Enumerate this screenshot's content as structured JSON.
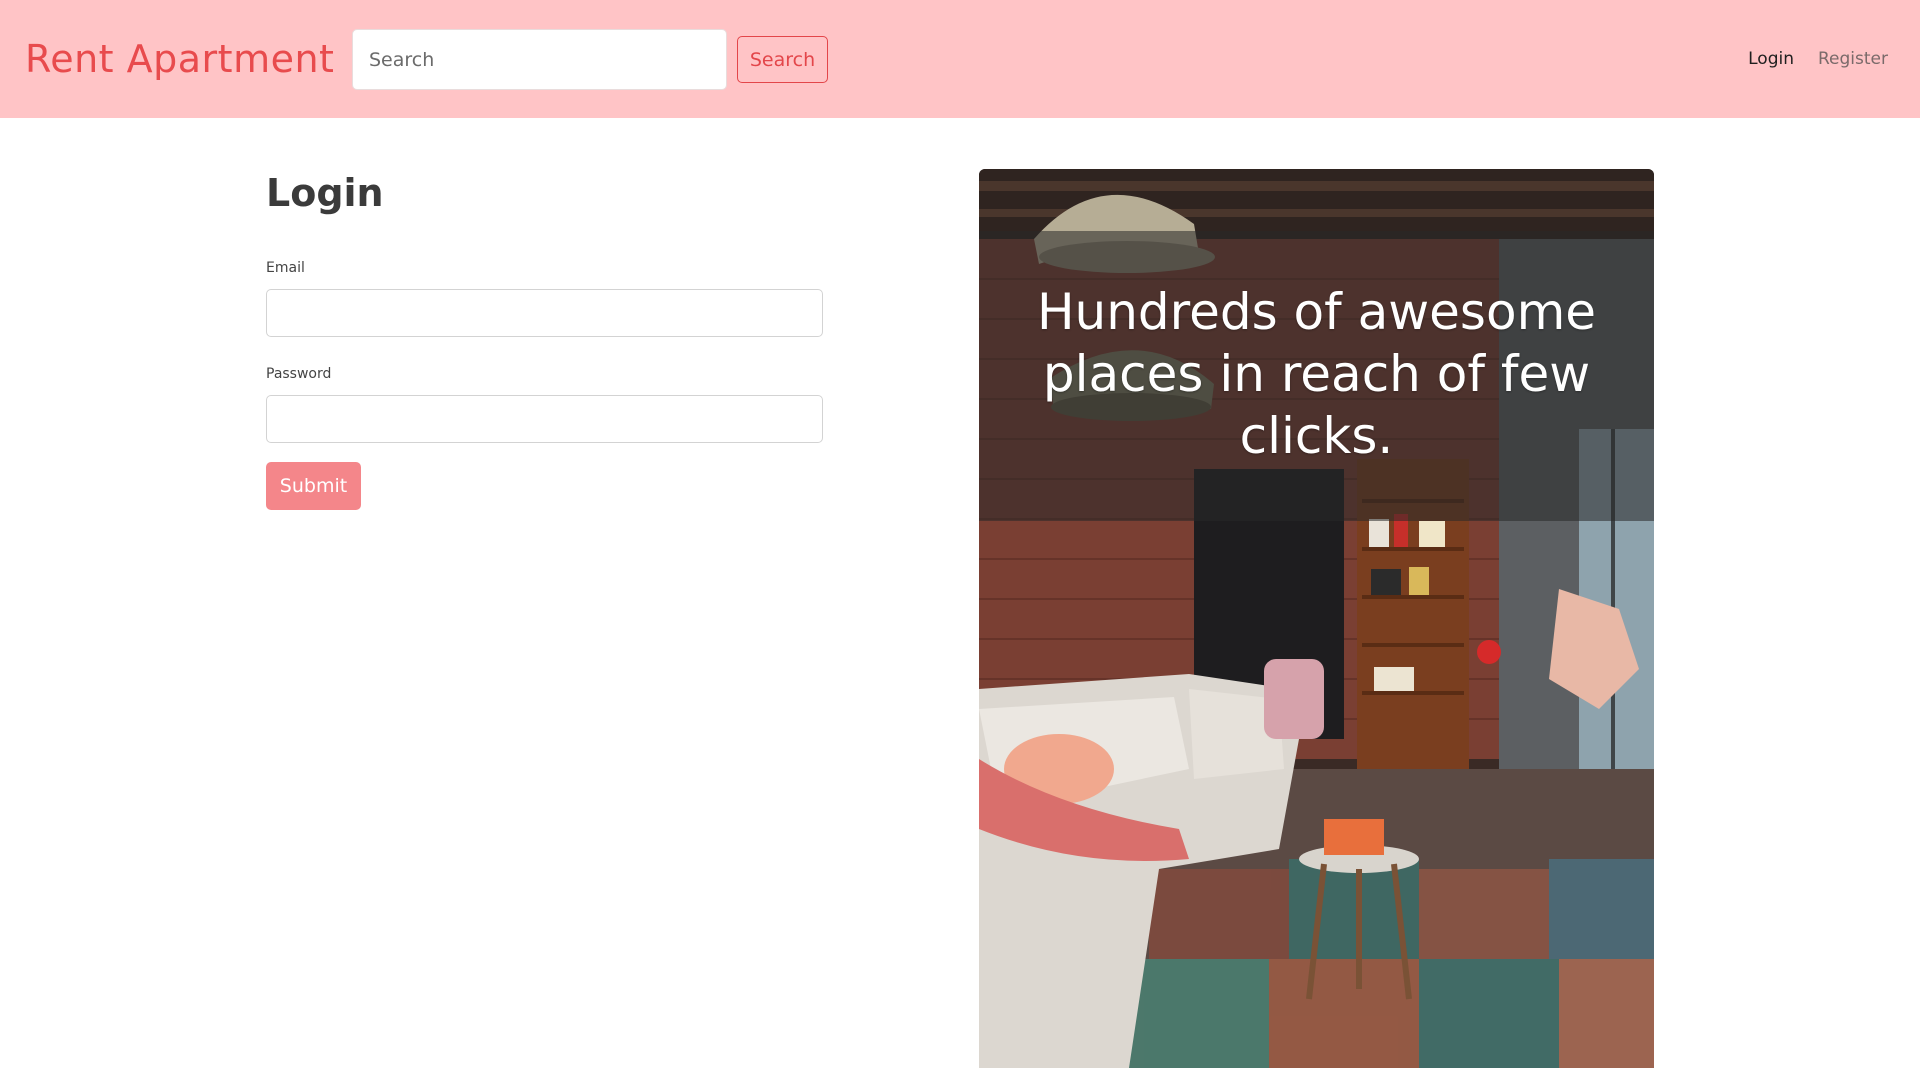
{
  "navbar": {
    "brand": "Rent Apartment",
    "search": {
      "placeholder": "Search",
      "button_label": "Search"
    },
    "links": {
      "login": "Login",
      "register": "Register"
    }
  },
  "login_form": {
    "title": "Login",
    "email_label": "Email",
    "password_label": "Password",
    "submit_label": "Submit"
  },
  "hero": {
    "tagline": "Hundreds of awesome places in reach of few clicks."
  },
  "colors": {
    "navbar_bg": "#ffc4c6",
    "brand": "#e84b4d",
    "outline_button": "#e3464a",
    "submit_button": "#f4868a"
  }
}
